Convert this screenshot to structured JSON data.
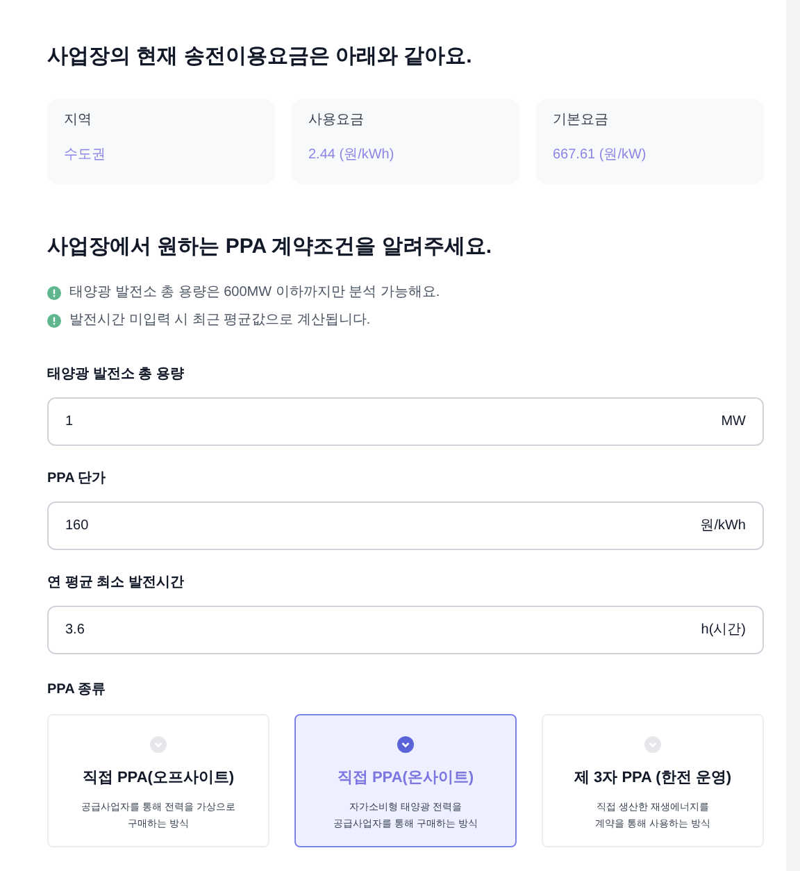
{
  "fee_section": {
    "title": "사업장의 현재 송전이용요금은 아래와 같아요.",
    "cards": [
      {
        "label": "지역",
        "value": "수도권"
      },
      {
        "label": "사용요금",
        "value": "2.44 (원/kWh)"
      },
      {
        "label": "기본요금",
        "value": "667.61 (원/kW)"
      }
    ]
  },
  "ppa_section": {
    "title": "사업장에서 원하는 PPA 계약조건을 알려주세요.",
    "notes": [
      "태양광 발전소 총 용량은 600MW 이하까지만 분석 가능해요.",
      "발전시간 미입력 시 최근 평균값으로 계산됩니다."
    ],
    "fields": [
      {
        "label": "태양광 발전소 총 용량",
        "value": "1",
        "unit": "MW"
      },
      {
        "label": "PPA 단가",
        "value": "160",
        "unit": "원/kWh"
      },
      {
        "label": "연 평균 최소 발전시간",
        "value": "3.6",
        "unit": "h(시간)"
      }
    ],
    "type_label": "PPA 종류",
    "types": [
      {
        "title": "직접 PPA(오프사이트)",
        "description": [
          "공급사업자를 통해 전력을 가상으로",
          "구매하는 방식"
        ],
        "selected": false
      },
      {
        "title": "직접 PPA(온사이트)",
        "description": [
          "자가소비형 태양광 전력을",
          "공급사업자를 통해 구매하는 방식"
        ],
        "selected": true
      },
      {
        "title": "제 3자 PPA (한전 운영)",
        "description": [
          "직접 생산한 재생에너지를",
          "계약을 통해 사용하는 방식"
        ],
        "selected": false
      }
    ]
  }
}
